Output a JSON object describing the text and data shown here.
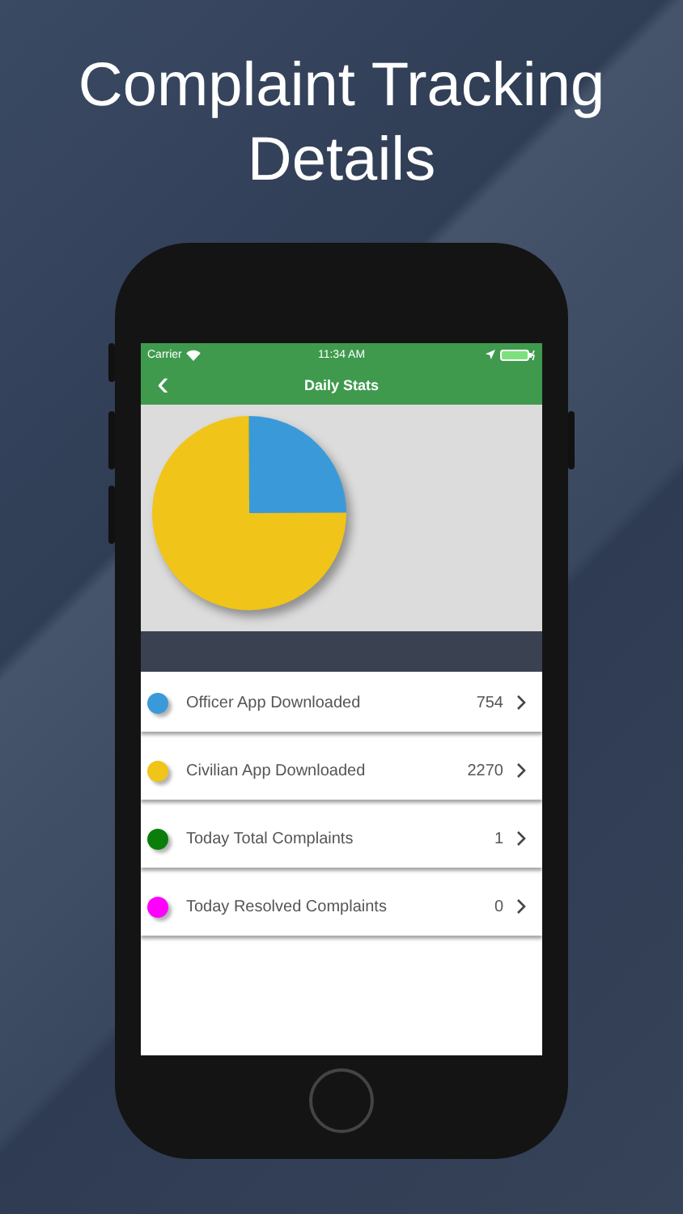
{
  "headline": "Complaint Tracking Details",
  "status_bar": {
    "carrier": "Carrier",
    "time": "11:34 AM"
  },
  "nav_bar": {
    "back": "‹",
    "title": "Daily Stats"
  },
  "stats": [
    {
      "label": "Officer App Downloaded",
      "value": "754",
      "color": "#3a9ad9"
    },
    {
      "label": "Civilian App Downloaded",
      "value": "2270",
      "color": "#f0c419"
    },
    {
      "label": "Today Total Complaints",
      "value": "1",
      "color": "#0a7d0a"
    },
    {
      "label": "Today Resolved Complaints",
      "value": "0",
      "color": "#ff00ff"
    }
  ]
}
